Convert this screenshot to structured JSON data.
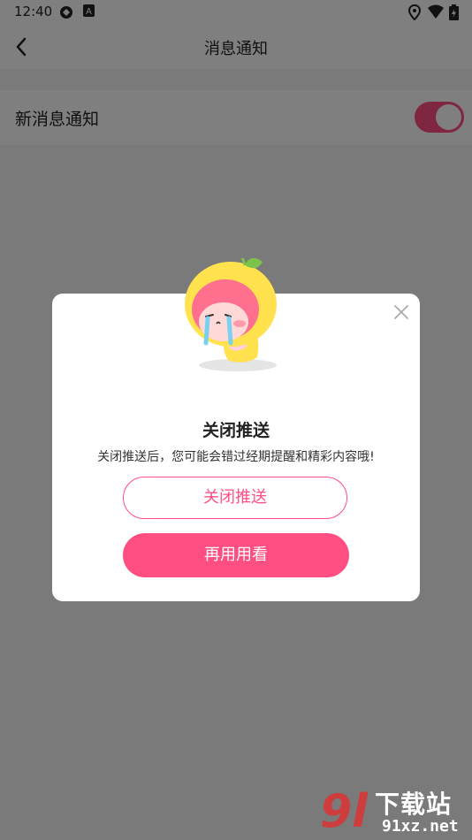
{
  "status_bar": {
    "time": "12:40",
    "icons": [
      "sync-icon",
      "a-badge-icon",
      "location-icon",
      "wifi-icon",
      "battery-charging-icon"
    ]
  },
  "header": {
    "title": "消息通知",
    "back_icon": "chevron-left-icon"
  },
  "settings": {
    "new_message_label": "新消息通知",
    "toggle_on": true
  },
  "dialog": {
    "title": "关闭推送",
    "message": "关闭推送后，您可能会错过经期提醒和精彩内容哦!",
    "close_button_label": "关闭推送",
    "keep_button_label": "再用用看",
    "close_icon": "close-icon",
    "mascot": "crying-mascot"
  },
  "watermark": {
    "title": "下载站",
    "url": "91xz.net"
  },
  "colors": {
    "accent": "#ff4f82",
    "overlay": "rgba(0,0,0,0.5)",
    "toggle_off": "#dddddd"
  }
}
